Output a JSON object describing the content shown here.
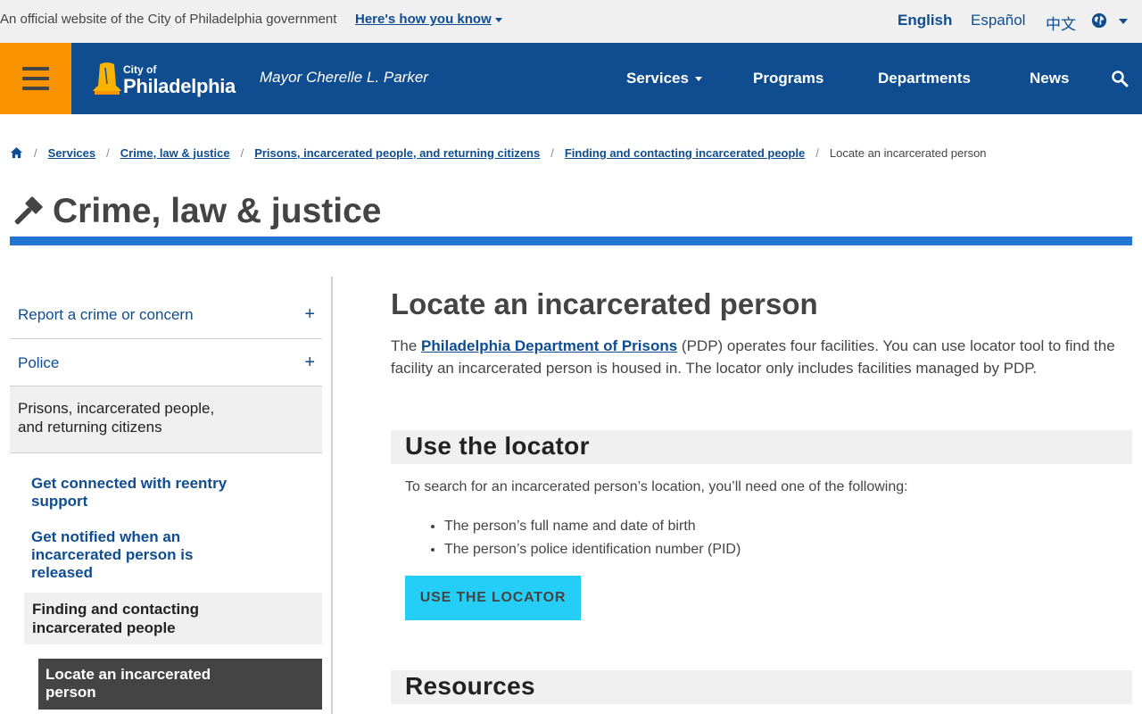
{
  "official_bar": {
    "text": "An official website of the City of Philadelphia government",
    "how_link": "Here's how you know",
    "languages": [
      "English",
      "Español",
      "中文"
    ]
  },
  "header": {
    "logo_small": "City of",
    "logo_big": "Philadelphia",
    "mayor": "Mayor Cherelle L. Parker",
    "nav": [
      "Services",
      "Programs",
      "Departments",
      "News"
    ]
  },
  "breadcrumb": {
    "links": [
      "Services",
      "Crime, law & justice",
      "Prisons, incarcerated people, and returning citizens",
      "Finding and contacting incarcerated people"
    ],
    "current": "Locate an incarcerated person"
  },
  "section_title": "Crime, law & justice",
  "sidebar": {
    "top_items": [
      "Report a crime or concern",
      "Police"
    ],
    "active_parent": "Prisons, incarcerated people, and returning citizens",
    "sub_items": [
      "Get connected with reentry support",
      "Get notified when an incarcerated person is released"
    ],
    "active_sub": "Finding and contacting incarcerated people",
    "current": "Locate an incarcerated person"
  },
  "main": {
    "title": "Locate an incarcerated person",
    "intro_before": "The ",
    "intro_link": "Philadelphia Department of Prisons",
    "intro_after": " (PDP) operates four facilities. You can use locator tool to find the facility an incarcerated person is housed in. The locator only includes facilities managed by PDP.",
    "locator_heading": "Use the locator",
    "locator_lead": "To search for an incarcerated person’s location, you’ll need one of the following:",
    "bullets": [
      "The person’s full name and date of birth",
      "The person’s police identification number (PID)"
    ],
    "locator_button": "USE THE LOCATOR",
    "resources_heading": "Resources"
  },
  "colors": {
    "brand_blue": "#0f4d90",
    "accent_orange": "#f99300",
    "rule_blue": "#2176d2",
    "button_cyan": "#25cef7"
  },
  "icons": [
    "menu-icon",
    "liberty-bell-logo",
    "search-icon",
    "home-icon",
    "gavel-icon",
    "globe-icon",
    "plus-icon"
  ]
}
